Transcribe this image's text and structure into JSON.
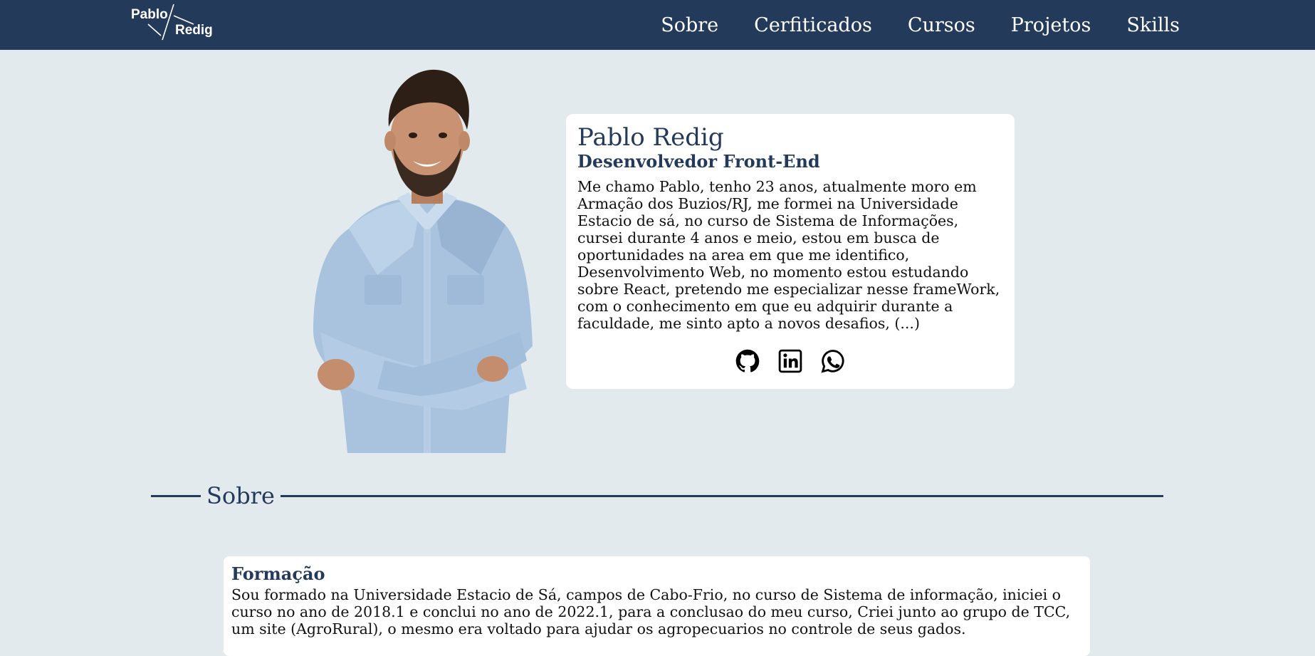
{
  "navbar": {
    "logo_text_top": "Pablo",
    "logo_text_bottom": "Redig",
    "links": [
      {
        "label": "Sobre"
      },
      {
        "label": "Cerfiticados"
      },
      {
        "label": "Cursos"
      },
      {
        "label": "Projetos"
      },
      {
        "label": "Skills"
      }
    ]
  },
  "profile": {
    "name": "Pablo Redig",
    "role": "Desenvolvedor Front-End",
    "bio": "Me chamo Pablo, tenho 23 anos, atualmente moro em Armação dos Buzios/RJ, me formei na Universidade Estacio de sá, no curso de Sistema de Informações, cursei durante 4 anos e meio, estou em busca de oportunidades na area em que me identifico, Desenvolvimento Web, no momento estou estudando sobre React, pretendo me especializar nesse frameWork, com o conhecimento em que eu adquirir durante a faculdade, me sinto apto a novos desafios, (...)",
    "social_icons": [
      "github-icon",
      "linkedin-icon",
      "whatsapp-icon"
    ]
  },
  "section": {
    "heading": "Sobre"
  },
  "formacao": {
    "title": "Formação",
    "text": "Sou formado na Universidade Estacio de Sá, campos de Cabo-Frio, no curso de Sistema de informação, iniciei o curso no ano de 2018.1 e conclui no ano de 2022.1, para a conclusao do meu curso, Criei junto ao grupo de TCC, um site (AgroRural), o mesmo era voltado para ajudar os agropecuarios no controle de seus gados."
  },
  "colors": {
    "navbar_bg": "#233a5b",
    "page_bg": "#e3eaee",
    "card_bg": "#ffffff",
    "accent": "#233a5b"
  }
}
